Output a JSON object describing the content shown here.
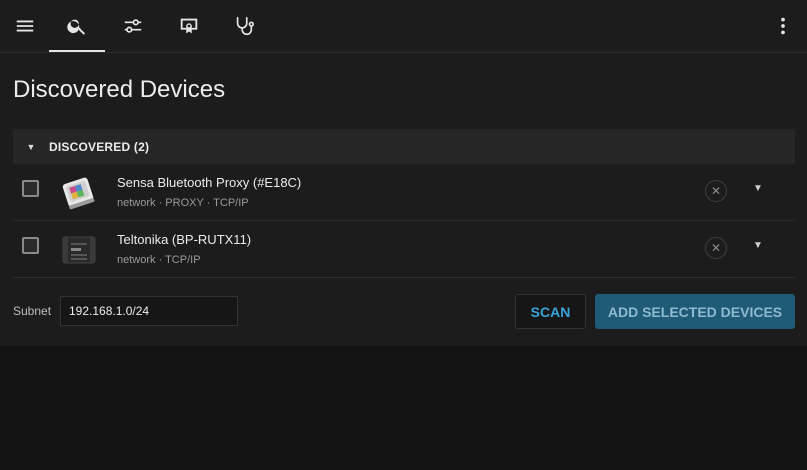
{
  "page": {
    "title": "Discovered Devices"
  },
  "toolbar": {
    "icons": [
      "menu-icon",
      "search-icon",
      "sliders-icon",
      "certificate-icon",
      "stethoscope-icon",
      "more-vert-icon"
    ],
    "active_tab": "search"
  },
  "group": {
    "label": "DISCOVERED (2)",
    "expanded": true
  },
  "devices": [
    {
      "name": "Sensa Bluetooth Proxy (#E18C)",
      "meta": "network · PROXY · TCP/IP",
      "checked": false
    },
    {
      "name": "Teltonika (BP-RUTX11)",
      "meta": "network · TCP/IP",
      "checked": false
    }
  ],
  "footer": {
    "subnet_label": "Subnet",
    "subnet_value": "192.168.1.0/24",
    "scan_label": "SCAN",
    "add_label": "ADD SELECTED DEVICES"
  },
  "colors": {
    "accent": "#3aa4d8",
    "primary_button": "#1f5a76",
    "background": "#1c1c1c"
  }
}
